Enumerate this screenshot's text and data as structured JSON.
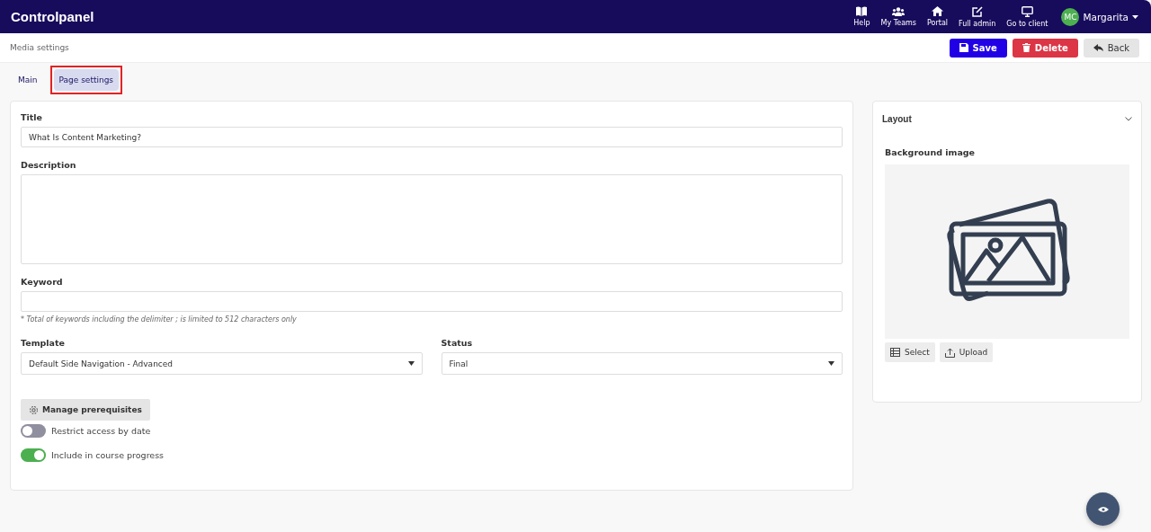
{
  "app": {
    "title": "Controlpanel"
  },
  "nav_items": [
    {
      "label": "Help",
      "kind": "book"
    },
    {
      "label": "My Teams",
      "kind": "team"
    },
    {
      "label": "Portal",
      "kind": "home"
    },
    {
      "label": "Full admin",
      "kind": "edit"
    },
    {
      "label": "Go to client",
      "kind": "monitor"
    }
  ],
  "user": {
    "initials": "MC",
    "name": "Margarita"
  },
  "breadcrumb": "Media settings",
  "actions": [
    {
      "label": "Save",
      "kind": "save"
    },
    {
      "label": "Delete",
      "kind": "delete"
    },
    {
      "label": "Back",
      "kind": "back"
    }
  ],
  "tabs": [
    {
      "label": "Main",
      "selected": false,
      "highlighted": false
    },
    {
      "label": "Page settings",
      "selected": true,
      "highlighted": true
    }
  ],
  "form": {
    "title_label": "Title",
    "title_value": "What Is Content Marketing?",
    "description_label": "Description",
    "keyword_label": "Keyword",
    "keyword_hint": "* Total of keywords including the delimiter ; is limited to 512 characters only",
    "template_label": "Template",
    "template_value": "Default Side Navigation - Advanced",
    "status_label": "Status",
    "status_value": "Final",
    "prerequisites_button": "Manage prerequisites",
    "toggles": [
      {
        "label": "Restrict access by date",
        "on": false
      },
      {
        "label": "Include in course progress",
        "on": true
      }
    ]
  },
  "layout_panel": {
    "title": "Layout",
    "expanded": true,
    "image_label": "Background image",
    "buttons": [
      {
        "label": "Select",
        "kind": "select"
      },
      {
        "label": "Upload",
        "kind": "upload"
      }
    ]
  }
}
